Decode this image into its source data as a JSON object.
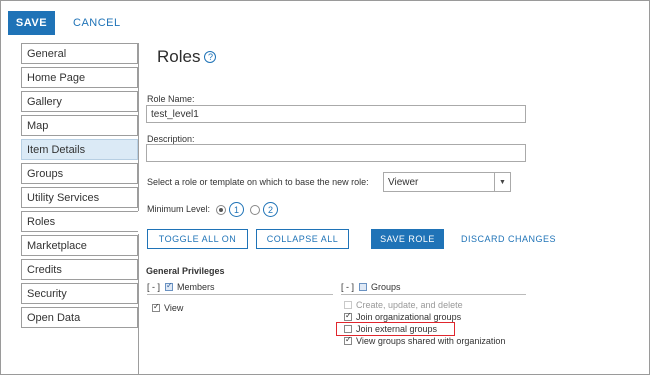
{
  "toolbar": {
    "save_label": "SAVE",
    "cancel_label": "CANCEL"
  },
  "sidebar": {
    "items": [
      {
        "label": "General"
      },
      {
        "label": "Home Page"
      },
      {
        "label": "Gallery"
      },
      {
        "label": "Map"
      },
      {
        "label": "Item Details"
      },
      {
        "label": "Groups"
      },
      {
        "label": "Utility Services"
      },
      {
        "label": "Roles"
      },
      {
        "label": "Marketplace"
      },
      {
        "label": "Credits"
      },
      {
        "label": "Security"
      },
      {
        "label": "Open Data"
      }
    ],
    "hovered_item": "Item Details",
    "selected_item": "Roles"
  },
  "page": {
    "title": "Roles",
    "help_icon": "?"
  },
  "form": {
    "role_name_label": "Role Name:",
    "role_name_value": "test_level1",
    "description_label": "Description:",
    "description_value": "",
    "template_label": "Select a role or template on which to base the new role:",
    "template_value": "Viewer",
    "min_level_label": "Minimum Level:",
    "level_1": "1",
    "level_2": "2",
    "selected_level": "1"
  },
  "actions": {
    "toggle_all_on": "TOGGLE ALL ON",
    "collapse_all": "COLLAPSE ALL",
    "save_role": "SAVE ROLE",
    "discard_changes": "DISCARD CHANGES"
  },
  "privileges": {
    "section_title": "General Privileges",
    "members_toggle": "[ - ]",
    "members_label": "Members",
    "groups_toggle": "[ - ]",
    "groups_label": "Groups",
    "members_items": [
      {
        "label": "View",
        "checked": true
      }
    ],
    "groups_items": [
      {
        "label": "Create, update, and delete",
        "checked": false,
        "disabled": true
      },
      {
        "label": "Join organizational groups",
        "checked": true,
        "disabled": false
      },
      {
        "label": "Join external groups",
        "checked": false,
        "disabled": false
      },
      {
        "label": "View groups shared with organization",
        "checked": true,
        "disabled": false
      }
    ]
  },
  "colors": {
    "accent": "#1f73b7",
    "highlight_border": "#e0262d",
    "hover_background": "#dbeaf6"
  }
}
